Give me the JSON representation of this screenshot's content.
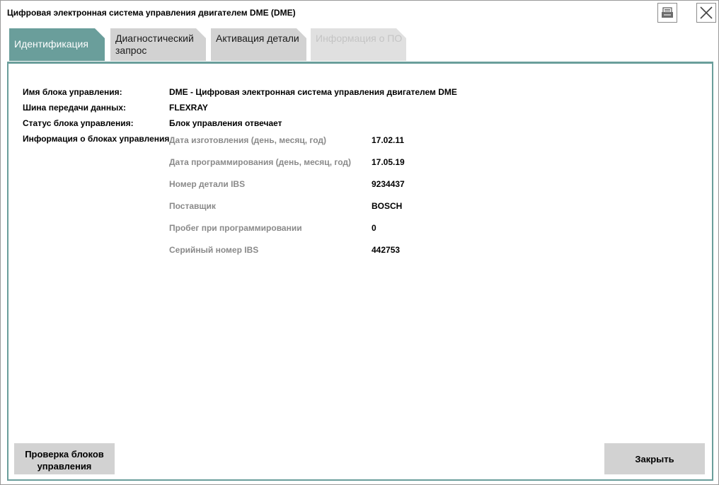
{
  "window": {
    "title": "Цифровая электронная система управления двигателем DME (DME)"
  },
  "titlebar_buttons": {
    "print_icon": "printer-icon",
    "close_icon": "close-icon"
  },
  "tabs": [
    {
      "label": "Идентификация",
      "state": "active"
    },
    {
      "label": "Диагностический запрос",
      "state": "normal"
    },
    {
      "label": "Активация детали",
      "state": "normal"
    },
    {
      "label": "Информация о ПО",
      "state": "disabled"
    }
  ],
  "details": {
    "unit_name_label": "Имя блока управления:",
    "unit_name_value": "DME - Цифровая электронная система управления двигателем DME",
    "bus_label": "Шина передачи данных:",
    "bus_value": "FLEXRAY",
    "status_label": "Статус блока управления:",
    "status_value": "Блок управления отвечает",
    "info_label": "Информация о блоках управления"
  },
  "unit_info": [
    {
      "label": "Дата изготовления (день, месяц, год)",
      "value": "17.02.11"
    },
    {
      "label": "Дата программирования (день, месяц, год)",
      "value": "17.05.19"
    },
    {
      "label": "Номер детали IBS",
      "value": "9234437"
    },
    {
      "label": "Поставщик",
      "value": "BOSCH"
    },
    {
      "label": "Пробег при программировании",
      "value": "0"
    },
    {
      "label": "Серийный номер IBS",
      "value": "442753"
    }
  ],
  "buttons": {
    "check_units": "Проверка блоков управления",
    "close": "Закрыть"
  },
  "colors": {
    "accent": "#6a9e9b",
    "tab_inactive": "#d2d2d2",
    "muted_text": "#8a8a8a"
  }
}
